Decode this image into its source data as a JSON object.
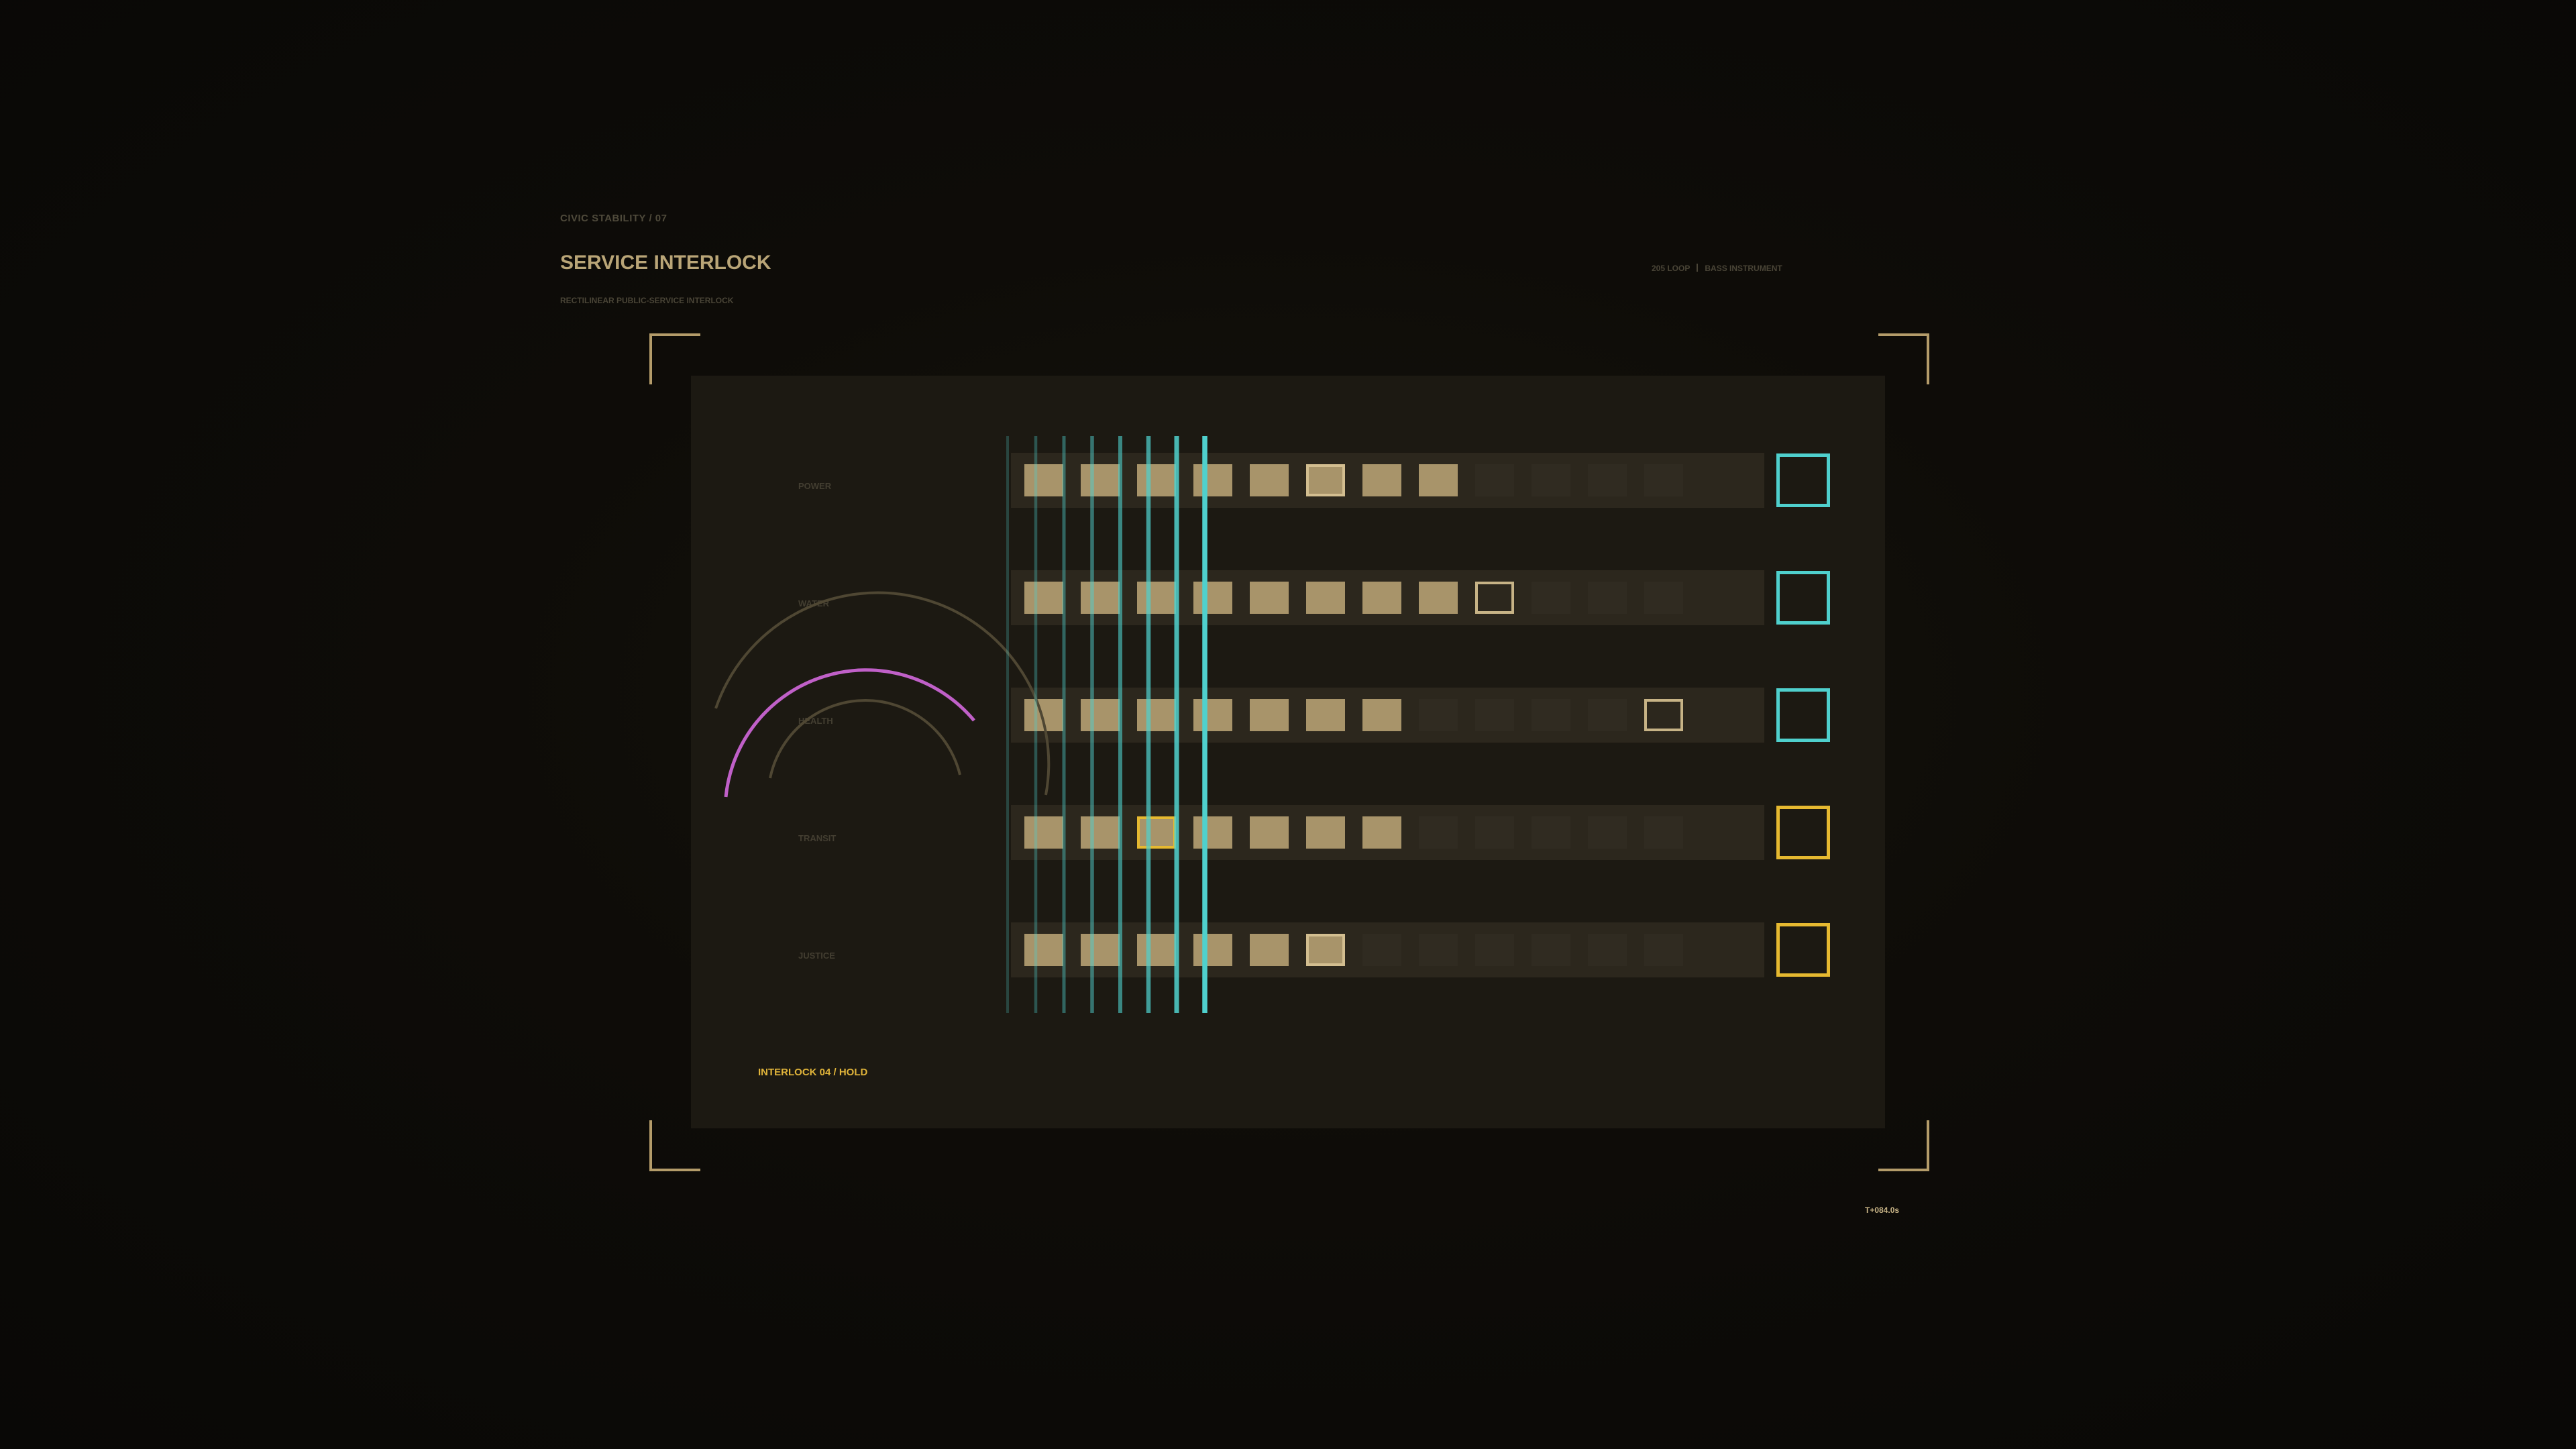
{
  "header": {
    "kicker": "CIVIC STABILITY / 07",
    "title": "SERVICE INTERLOCK",
    "subtitle": "RECTILINEAR PUBLIC-SERVICE INTERLOCK",
    "tag_left": "205 LOOP",
    "tag_right": "BASS INSTRUMENT"
  },
  "colors": {
    "background": "#0a0906",
    "panel": "#1c1912",
    "cell_on": "#a8946a",
    "cell_off": "#302b21",
    "cyan": "#4fd0cd",
    "amber": "#e6b930",
    "magenta": "#c060c8"
  },
  "grid": {
    "steps": 12,
    "rows": [
      {
        "label": "POWER",
        "level": 8,
        "cursor": 6,
        "cursor_style": "normal",
        "status": "cyan"
      },
      {
        "label": "WATER",
        "level": 8,
        "cursor": 9,
        "cursor_style": "ghost",
        "status": "cyan"
      },
      {
        "label": "HEALTH",
        "level": 7,
        "cursor": 12,
        "cursor_style": "ghost",
        "status": "cyan"
      },
      {
        "label": "TRANSIT",
        "level": 7,
        "cursor": 3,
        "cursor_style": "alert",
        "status": "amber"
      },
      {
        "label": "JUSTICE",
        "level": 6,
        "cursor": 6,
        "cursor_style": "normal",
        "status": "amber"
      }
    ]
  },
  "bus": {
    "lines": 8,
    "intensity": [
      0.25,
      0.33,
      0.42,
      0.5,
      0.6,
      0.72,
      0.86,
      1.0
    ]
  },
  "status": {
    "interlock": "INTERLOCK 04 / HOLD",
    "timer": "T+084.0s"
  }
}
